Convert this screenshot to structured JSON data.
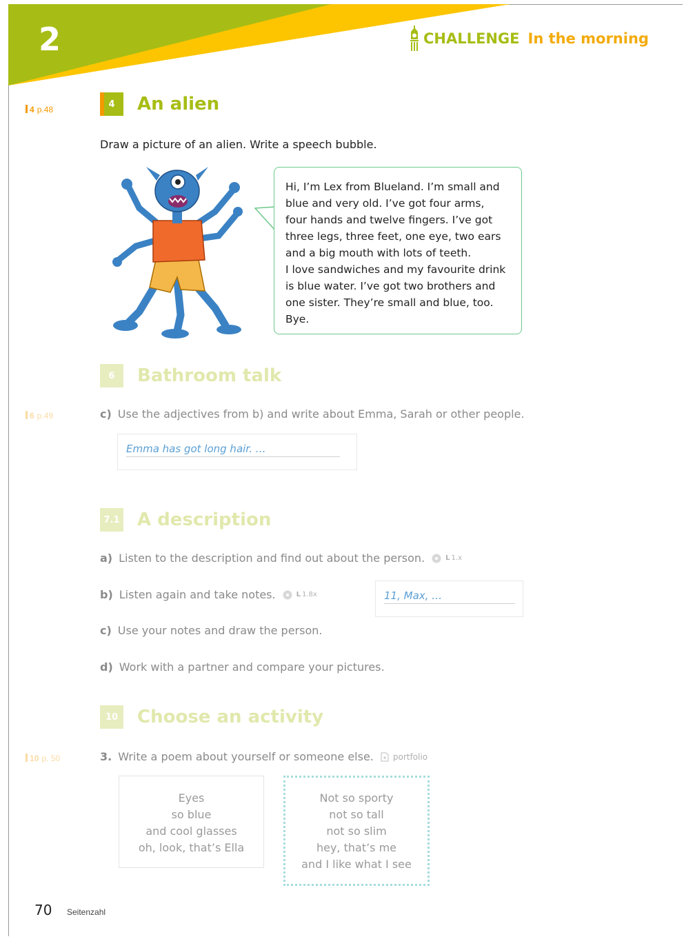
{
  "header": {
    "chapter": "2",
    "challenge_label": "CHALLENGE",
    "topic": "In the morning",
    "colors": {
      "green": "#a7bd15",
      "yellow": "#fcc500",
      "orange": "#f39a00"
    }
  },
  "ex4": {
    "ref_num": "4",
    "ref_page": "p.48",
    "number": "4",
    "title": "An alien",
    "instruction": "Draw a picture of an alien. Write a speech bubble.",
    "bubble_lines": [
      "Hi, I’m Lex from Blueland. I’m small and",
      "blue and very old. I’ve got four arms,",
      "four hands and twelve fingers. I’ve got",
      "three legs, three feet, one eye, two ears",
      "and a big mouth with lots of teeth.",
      "I love sandwiches and my favourite drink",
      "is blue water. I’ve got two brothers and",
      "one sister. They’re small and blue, too.",
      "Bye."
    ]
  },
  "ex6": {
    "number": "6",
    "title": "Bathroom talk",
    "ref_num": "6",
    "ref_page": "p.49",
    "task_letter": "c)",
    "task_text": "Use the adjectives from b) and write about Emma, Sarah or other people.",
    "answer": "Emma has got long hair. …"
  },
  "ex71": {
    "number": "7.1",
    "title": "A description",
    "tasks": [
      {
        "letter": "a)",
        "text": "Listen to the description and find out about the person.",
        "audio_prefix": "L",
        "audio_code": "1.x"
      },
      {
        "letter": "b)",
        "text": "Listen again and take notes.",
        "audio_prefix": "L",
        "audio_code": "1.8x"
      },
      {
        "letter": "c)",
        "text": "Use your notes and draw the person."
      },
      {
        "letter": "d)",
        "text": "Work with a partner and compare your pictures."
      }
    ],
    "notes_answer": "11, Max, …"
  },
  "ex10": {
    "number": "10",
    "title": "Choose an activity",
    "ref_num": "10",
    "ref_page": "p. 50",
    "task_letter": "3.",
    "task_text": "Write a poem about yourself or someone else.",
    "portfolio_label": "portfolio",
    "poem1": [
      "Eyes",
      "so blue",
      "and cool glasses",
      "oh, look, that’s Ella"
    ],
    "poem2": [
      "Not so sporty",
      "not so tall",
      "not so slim",
      "hey, that’s me",
      "and I like what I see"
    ]
  },
  "footer": {
    "page_number": "70",
    "label": "Seitenzahl"
  }
}
